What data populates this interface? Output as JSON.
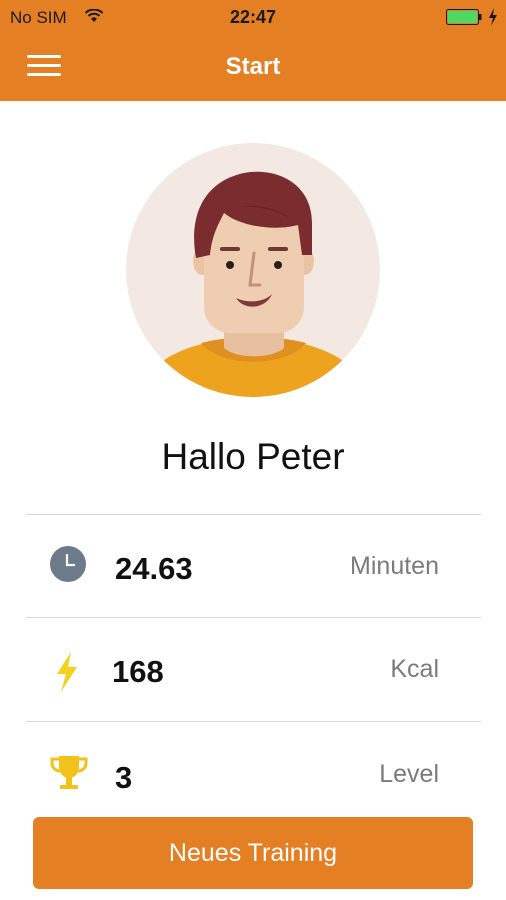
{
  "status_bar": {
    "carrier": "No SIM",
    "time": "22:47"
  },
  "nav": {
    "title": "Start"
  },
  "profile": {
    "greeting": "Hallo Peter"
  },
  "stats": [
    {
      "icon": "clock-icon",
      "value": "24.63",
      "unit": "Minuten"
    },
    {
      "icon": "lightning-icon",
      "value": "168",
      "unit": "Kcal"
    },
    {
      "icon": "trophy-icon",
      "value": "3",
      "unit": "Level"
    }
  ],
  "actions": {
    "new_training_label": "Neues Training"
  },
  "colors": {
    "accent": "#e57f24",
    "battery": "#4cd964",
    "clock_icon": "#6d7a8a",
    "lightning": "#f4d11c",
    "trophy": "#f2c21b"
  }
}
